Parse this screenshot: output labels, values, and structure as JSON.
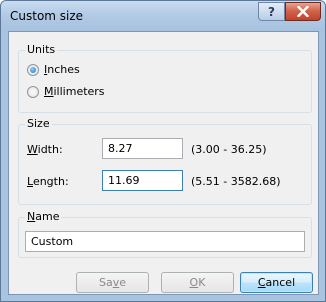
{
  "window": {
    "title": "Custom size",
    "help_glyph": "?",
    "close_icon": "close-icon"
  },
  "units": {
    "group_label": "Units",
    "options": [
      {
        "label": "Inches",
        "accel": "I",
        "rest": "nches",
        "checked": true
      },
      {
        "label": "Millimeters",
        "accel": "M",
        "rest": "illimeters",
        "checked": false
      }
    ]
  },
  "size": {
    "group_label": "Size",
    "width": {
      "label": "Width:",
      "accel": "W",
      "rest": "idth:",
      "value": "8.27",
      "range": "(3.00 - 36.25)"
    },
    "length": {
      "label": "Length:",
      "accel": "L",
      "rest": "ength:",
      "value": "11.69",
      "range": "(5.51 - 3582.68)"
    }
  },
  "name": {
    "group_label": "Name",
    "accel": "N",
    "rest": "ame",
    "value": "Custom"
  },
  "buttons": {
    "save": {
      "label": "Save",
      "pre": "Sa",
      "accel": "v",
      "post": "e",
      "enabled": false
    },
    "ok": {
      "label": "OK",
      "pre": "",
      "accel": "O",
      "post": "K",
      "enabled": false
    },
    "cancel": {
      "label": "Cancel",
      "pre": "",
      "accel": "C",
      "post": "ancel",
      "enabled": true
    }
  }
}
